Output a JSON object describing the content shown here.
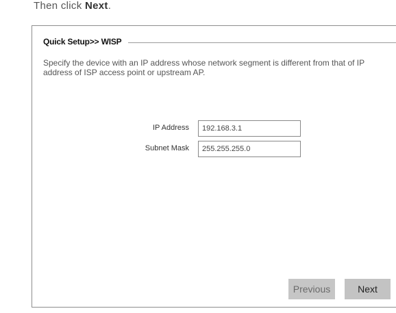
{
  "instruction": {
    "prefix": "Then click ",
    "emphasis": "Next",
    "suffix": "."
  },
  "panel": {
    "title": "Quick Setup>> WISP",
    "description": "Specify the device with an IP address whose network segment is different from that of IP address of ISP access point or upstream AP."
  },
  "fields": {
    "ip_address": {
      "label": "IP Address",
      "value": "192.168.3.1"
    },
    "subnet_mask": {
      "label": "Subnet Mask",
      "value": "255.255.255.0"
    }
  },
  "buttons": {
    "previous_label": "Previous",
    "next_label": "Next"
  }
}
